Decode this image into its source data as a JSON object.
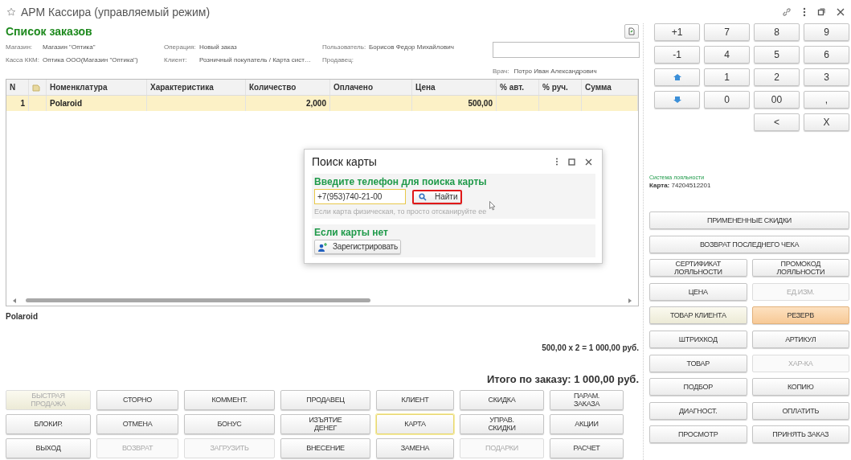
{
  "window": {
    "title": "АРМ Кассира (управляемый режим)"
  },
  "header": {
    "title": "Список заказов",
    "info_columns": [
      [
        {
          "label": "Магазин:",
          "value": "Магазин \"Оптика\""
        },
        {
          "label": "Касса ККМ:",
          "value": "Оптика ООО(Магазин \"Оптика\")"
        }
      ],
      [
        {
          "label": "Операция:",
          "value": "Новый заказ"
        },
        {
          "label": "Клиент:",
          "value": "Розничный покупатель / Карта сист…"
        }
      ],
      [
        {
          "label": "Пользователь:",
          "value": "Борисов Федор Михайлович"
        },
        {
          "label": "Продавец:"
        }
      ],
      [
        {
          "label": "Врач:",
          "value": "Потро Иван Александрович"
        }
      ]
    ]
  },
  "table": {
    "columns": [
      {
        "kind": "text",
        "label": "N"
      },
      {
        "kind": "icon"
      },
      {
        "kind": "text",
        "label": "Номенклатура"
      },
      {
        "kind": "text",
        "label": "Характеристика"
      },
      {
        "kind": "text",
        "label": "Количество"
      },
      {
        "kind": "text",
        "label": "Оплачено"
      },
      {
        "kind": "text",
        "label": "Цена"
      },
      {
        "kind": "text",
        "label": "% авт."
      },
      {
        "kind": "text",
        "label": "% руч."
      },
      {
        "kind": "text",
        "label": "Сумма"
      }
    ],
    "rows": [
      {
        "selected": true,
        "cells": [
          "1",
          null,
          "Polaroid",
          null,
          "2,000",
          null,
          "500,00",
          null,
          null,
          null
        ]
      }
    ]
  },
  "selected_item": "Polaroid",
  "calculation": "500,00  x 2  = 1 000,00 руб.",
  "total": "Итого по заказу: 1 000,00 руб.",
  "action_buttons": [
    {
      "label": "БЫСТРАЯ\nПРОДАЖА",
      "disabled": true,
      "focused": false,
      "kind": "cream"
    },
    {
      "label": "СТОРНО",
      "disabled": false,
      "focused": false,
      "kind": "plain"
    },
    {
      "label": "КОММЕНТ.",
      "disabled": false,
      "focused": false,
      "kind": "plain"
    },
    {
      "label": "ПРОДАВЕЦ",
      "disabled": false,
      "focused": false,
      "kind": "plain"
    },
    {
      "label": "КЛИЕНТ",
      "disabled": false,
      "focused": false,
      "kind": "plain"
    },
    {
      "label": "СКИДКА",
      "disabled": false,
      "focused": false,
      "kind": "plain"
    },
    {
      "label": "ПАРАМ.\nЗАКАЗА",
      "disabled": false,
      "focused": false,
      "kind": "plain"
    },
    {
      "label": "БЛОКИР.",
      "disabled": false,
      "focused": false,
      "kind": "plain"
    },
    {
      "label": "ОТМЕНА",
      "disabled": false,
      "focused": false,
      "kind": "plain"
    },
    {
      "label": "БОНУС",
      "disabled": false,
      "focused": false,
      "kind": "plain"
    },
    {
      "label": "ИЗЪЯТИЕ\nДЕНЕГ",
      "disabled": false,
      "focused": false,
      "kind": "plain"
    },
    {
      "label": "КАРТА",
      "disabled": false,
      "focused": true,
      "kind": "plain"
    },
    {
      "label": "УПРАВ.\nСКИДКИ",
      "disabled": false,
      "focused": false,
      "kind": "plain"
    },
    {
      "label": "АКЦИИ",
      "disabled": false,
      "focused": false,
      "kind": "plain"
    },
    {
      "label": "ВЫХОД",
      "disabled": false,
      "focused": false,
      "kind": "plain"
    },
    {
      "label": "ВОЗВРАТ",
      "disabled": true,
      "focused": false,
      "kind": "plain"
    },
    {
      "label": "ЗАГРУЗИТЬ",
      "disabled": true,
      "focused": false,
      "kind": "plain"
    },
    {
      "label": "ВНЕСЕНИЕ",
      "disabled": false,
      "focused": false,
      "kind": "plain"
    },
    {
      "label": "ЗАМЕНА",
      "disabled": false,
      "focused": false,
      "kind": "plain"
    },
    {
      "label": "ПОДАРКИ",
      "disabled": true,
      "focused": false,
      "kind": "plain"
    },
    {
      "label": "РАСЧЕТ",
      "disabled": false,
      "focused": false,
      "kind": "plain"
    }
  ],
  "keypad": {
    "rows": [
      [
        {
          "kind": "text",
          "label": "+1"
        },
        {
          "kind": "text",
          "label": "7"
        },
        {
          "kind": "text",
          "label": "8"
        },
        {
          "kind": "text",
          "label": "9"
        }
      ],
      [
        {
          "kind": "text",
          "label": "-1"
        },
        {
          "kind": "text",
          "label": "4"
        },
        {
          "kind": "text",
          "label": "5"
        },
        {
          "kind": "text",
          "label": "6"
        }
      ],
      [
        {
          "kind": "up"
        },
        {
          "kind": "text",
          "label": "1"
        },
        {
          "kind": "text",
          "label": "2"
        },
        {
          "kind": "text",
          "label": "3"
        }
      ],
      [
        {
          "kind": "down"
        },
        {
          "kind": "text",
          "label": "0"
        },
        {
          "kind": "text",
          "label": "00"
        },
        {
          "kind": "text",
          "label": ","
        }
      ],
      [
        "",
        "",
        {
          "kind": "text",
          "label": "<"
        },
        {
          "kind": "text",
          "label": "X"
        }
      ]
    ]
  },
  "loyalty": {
    "title": "Система лояльности",
    "card_label": "Карта:",
    "card_number": "74204512201"
  },
  "side_buttons": [
    {
      "label": "ПРИМЕНЕННЫЕ СКИДКИ",
      "wide": true,
      "disabled": false,
      "kind": "plain"
    },
    {
      "label": "ВОЗВРАТ ПОСЛЕДНЕГО ЧЕКА",
      "wide": true,
      "disabled": false,
      "kind": "plain"
    },
    {
      "label": "СЕРТИФИКАТ\nЛОЯЛЬНОСТИ",
      "wide": false,
      "disabled": false,
      "kind": "plain"
    },
    {
      "label": "ПРОМОКОД\nЛОЯЛЬНОСТИ",
      "wide": false,
      "disabled": false,
      "kind": "plain"
    },
    {
      "label": "ЦЕНА",
      "wide": false,
      "disabled": false,
      "kind": "plain"
    },
    {
      "label": "ЕД.ИЗМ.",
      "wide": false,
      "disabled": true,
      "kind": "plain"
    },
    {
      "label": "ТОВАР КЛИЕНТА",
      "wide": false,
      "disabled": false,
      "kind": "cream"
    },
    {
      "label": "РЕЗЕРВ",
      "wide": false,
      "disabled": false,
      "kind": "orange"
    },
    {
      "label": "ШТРИХКОД",
      "wide": false,
      "disabled": false,
      "kind": "plain"
    },
    {
      "label": "АРТИКУЛ",
      "wide": false,
      "disabled": false,
      "kind": "plain"
    },
    {
      "label": "ТОВАР",
      "wide": false,
      "disabled": false,
      "kind": "plain"
    },
    {
      "label": "ХАР-КА",
      "wide": false,
      "disabled": true,
      "kind": "plain"
    },
    {
      "label": "ПОДБОР",
      "wide": false,
      "disabled": false,
      "kind": "plain"
    },
    {
      "label": "КОПИЮ",
      "wide": false,
      "disabled": false,
      "kind": "plain"
    },
    {
      "label": "ДИАГНОСТ.",
      "wide": false,
      "disabled": false,
      "kind": "plain"
    },
    {
      "label": "ОПЛАТИТЬ",
      "wide": false,
      "disabled": false,
      "kind": "plain"
    },
    {
      "label": "ПРОСМОТР",
      "wide": false,
      "disabled": false,
      "kind": "plain"
    },
    {
      "label": "ПРИНЯТЬ ЗАКАЗ",
      "wide": false,
      "disabled": false,
      "kind": "plain"
    }
  ],
  "dialog": {
    "title": "Поиск карты",
    "phone_section": {
      "heading": "Введите телефон для поиска карты",
      "phone": "+7(953)740-21-00",
      "find_button": "Найти",
      "find_marked": true,
      "hint": "Если карта физическая, то просто отсканируйте ее"
    },
    "register_section": {
      "heading": "Если карты нет",
      "button": "Зарегистрировать"
    }
  }
}
